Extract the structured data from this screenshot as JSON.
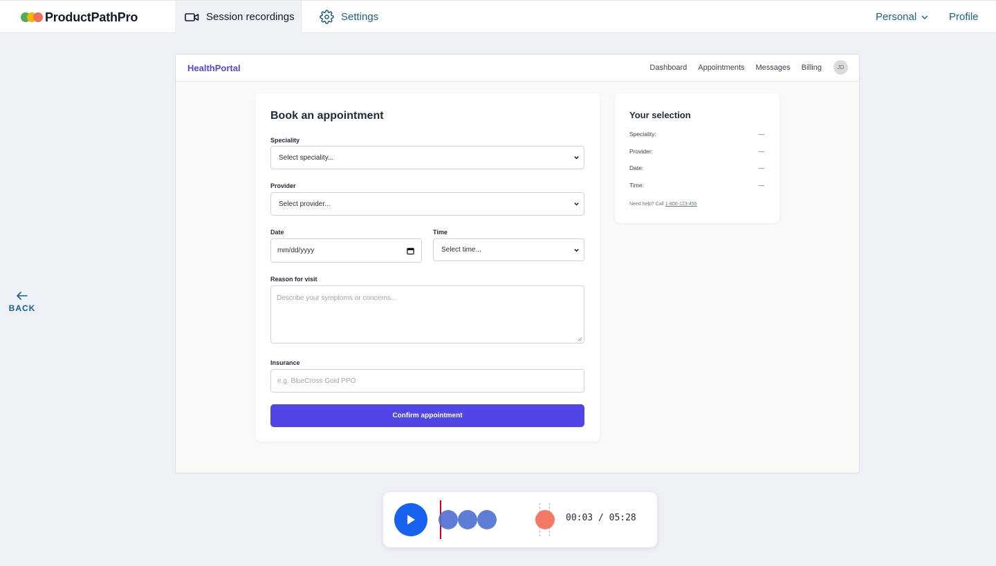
{
  "app": {
    "brand": "ProductPathPro",
    "brand_colors": [
      "#4caf50",
      "#f5b400",
      "#f26d5b"
    ],
    "tabs": [
      {
        "label": "Session recordings",
        "icon": "video-camera-icon",
        "active": true
      },
      {
        "label": "Settings",
        "icon": "gear-icon",
        "active": false
      }
    ],
    "workspace_label": "Personal",
    "profile_label": "Profile",
    "back_label": "BACK",
    "accent": "#1b5f8c"
  },
  "portal": {
    "brand": "HealthPortal",
    "nav": [
      "Dashboard",
      "Appointments",
      "Messages",
      "Billing"
    ],
    "avatar_initials": "JD",
    "form": {
      "title": "Book an appointment",
      "speciality_label": "Speciality",
      "speciality_value": "Select speciality...",
      "provider_label": "Provider",
      "provider_value": "Select provider...",
      "date_label": "Date",
      "date_placeholder": "mm/dd/yyyy",
      "time_label": "Time",
      "time_value": "Select time...",
      "reason_label": "Reason for visit",
      "reason_placeholder": "Describe your symptoms or concerns...",
      "insurance_label": "Insurance",
      "insurance_placeholder": "e.g. BlueCross Gold PPO",
      "submit_label": "Confirm appointment",
      "submit_color": "#4f46e5"
    },
    "selection": {
      "title": "Your selection",
      "rows": [
        {
          "label": "Speciality:",
          "value": "—"
        },
        {
          "label": "Provider:",
          "value": "—"
        },
        {
          "label": "Date:",
          "value": "—"
        },
        {
          "label": "Time:",
          "value": "—"
        }
      ],
      "help_prefix": "Need help? Call ",
      "help_phone": "1-800-123-456"
    }
  },
  "player": {
    "current_time": "00:03",
    "separator": "/",
    "total_time": "05:28",
    "play_color": "#1762ef"
  }
}
